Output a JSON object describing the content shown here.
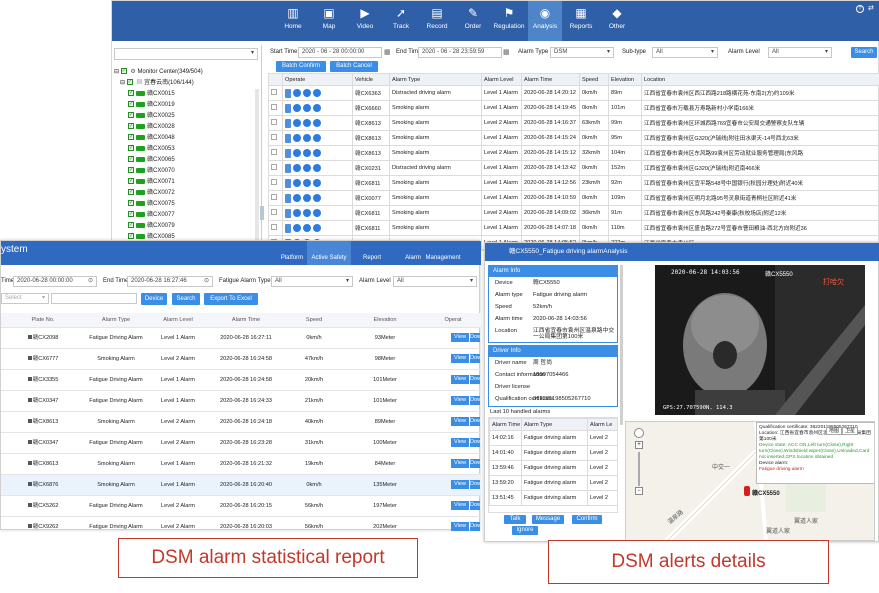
{
  "main": {
    "nav": [
      {
        "label": "Home",
        "icon": "bar-chart-icon"
      },
      {
        "label": "Map",
        "icon": "map-icon"
      },
      {
        "label": "Video",
        "icon": "video-icon"
      },
      {
        "label": "Track",
        "icon": "track-icon"
      },
      {
        "label": "Record",
        "icon": "record-icon"
      },
      {
        "label": "Order",
        "icon": "order-icon"
      },
      {
        "label": "Regulation",
        "icon": "regulation-icon"
      },
      {
        "label": "Analysis",
        "icon": "analysis-icon",
        "active": true
      },
      {
        "label": "Reports",
        "icon": "reports-icon"
      },
      {
        "label": "Other",
        "icon": "cube-icon"
      }
    ],
    "filters": {
      "start_label": "Start Time",
      "start_value": "2020 - 06 - 28 00:00:00",
      "end_label": "End Time",
      "end_value": "2020 - 06 - 28 23:59:59",
      "alarm_type_label": "Alarm Type",
      "alarm_type_value": "DSM",
      "subtype_label": "Sub-type",
      "subtype_value": "All",
      "alarm_level_label": "Alarm Level",
      "alarm_level_value": "All",
      "search": "Search",
      "batch_confirm": "Batch Confirm",
      "batch_cancel": "Batch Cancel"
    },
    "tree": {
      "root": "Monitor Center(349/504)",
      "group": "宜春云南(106/144)",
      "vehicles": [
        "赣CX0015",
        "赣CX0019",
        "赣CX0025",
        "赣CX0028",
        "赣CX0048",
        "赣CX0053",
        "赣CX0065",
        "赣CX0070",
        "赣CX0071",
        "赣CX0072",
        "赣CX0075",
        "赣CX0077",
        "赣CX0079",
        "赣CX0085"
      ]
    },
    "columns": [
      "Operate",
      "Vehicle",
      "Alarm Type",
      "Alarm Level",
      "Alarm Time",
      "Speed",
      "Elevation",
      "Location"
    ],
    "rows": [
      [
        "赣CX6363",
        "Distracted driving alarm",
        "Level 1 Alarm",
        "2020-06-28 14:20:12",
        "0km/h",
        "89m",
        "江西省宜春市袁州区西江西路218路横花苑-东南2(方)约109米"
      ],
      [
        "赣CX6660",
        "Smoking alarm",
        "Level 1 Alarm",
        "2020-06-28 14:19:45",
        "0km/h",
        "101m",
        "江西省宜春市万载县万寿路新村小学南166米"
      ],
      [
        "赣CX8613",
        "Smoking alarm",
        "Level 2 Alarm",
        "2020-06-28 14:16:37",
        "63km/h",
        "99m",
        "江西省宜春市袁州区环城西路769宜春市公安局交通警察支队车辆"
      ],
      [
        "赣CX8613",
        "Smoking alarm",
        "Level 1 Alarm",
        "2020-06-28 14:15:24",
        "0km/h",
        "95m",
        "江西省宜春市袁州区G320(沪瑞线)附往田水渠天-14号西北63米"
      ],
      [
        "赣CX8613",
        "Smoking alarm",
        "Level 2 Alarm",
        "2020-06-28 14:15:12",
        "32km/h",
        "104m",
        "江西省宜春市袁州区东风路99袁州区劳动就业服务管理局(东风路"
      ],
      [
        "赣CX0231",
        "Distracted driving alarm",
        "Level 1 Alarm",
        "2020-06-28 14:13:42",
        "0km/h",
        "152m",
        "江西省宜春市袁州区G320(沪瑞线)附近南466米"
      ],
      [
        "赣CX6811",
        "Smoking alarm",
        "Level 1 Alarm",
        "2020-06-28 14:12:56",
        "23km/h",
        "92m",
        "江西省宜春市袁州区宜平路548号中国银行(秋园分理处)附近40米"
      ],
      [
        "赣CX0077",
        "Smoking alarm",
        "Level 1 Alarm",
        "2020-06-28 14:10:59",
        "0km/h",
        "109m",
        "江西省宜春市袁州区明月北路95号灵泉街道青桐社区附近41米"
      ],
      [
        "赣CX6811",
        "Smoking alarm",
        "Level 2 Alarm",
        "2020-06-28 14:09:02",
        "36km/h",
        "91m",
        "江西省宜春市袁州区东风路242号秦康(秋校场店)附近12米"
      ],
      [
        "赣CX6811",
        "Smoking alarm",
        "Level 1 Alarm",
        "2020-06-28 14:07:18",
        "0km/h",
        "110m",
        "江西省宜春市袁州区盛吉路272号宜春市曹田粮油-西北方向附近36"
      ],
      [
        "赣CX5550",
        "Fatigue driving alarm",
        "Level 1 Alarm",
        "2020-06-28 14:05:52",
        "0km/h",
        "222m",
        "江西省宜春市袁州区"
      ]
    ]
  },
  "report": {
    "title": "ystem",
    "tabs": [
      "Platform",
      "Active Safety",
      "Report",
      "Alarm",
      "Management"
    ],
    "start_label": "Time",
    "start_value": "2020-06-28 00:00:00",
    "end_label": "End Time",
    "end_value": "2020-06-28 16:27:46",
    "fat_label": "Fatigue Alarm Type",
    "fat_value": "All",
    "alarm_level_label": "Alarm Level",
    "alarm_level_value": "All",
    "select_ph": "Select",
    "device": "Device",
    "search": "Search",
    "export": "Export To Excel",
    "columns": [
      "Plate No.",
      "Alarm Type",
      "Alarm Level",
      "Alarm Time",
      "Speed",
      "Elevation",
      "Operat"
    ],
    "view": "View",
    "down": "Dow",
    "rows": [
      [
        "赣CX2098",
        "Fatigue Driving Alarm",
        "Level 1 Alarm",
        "2020-06-28 16:27:11",
        "0km/h",
        "93Meter"
      ],
      [
        "赣CX6777",
        "Smoking Alarm",
        "Level 2 Alarm",
        "2020-06-28 16:24:58",
        "47km/h",
        "98Meter"
      ],
      [
        "赣CX3355",
        "Fatigue Driving Alarm",
        "Level 1 Alarm",
        "2020-06-28 16:24:58",
        "20km/h",
        "101Meter"
      ],
      [
        "赣CX0347",
        "Fatigue Driving Alarm",
        "Level 1 Alarm",
        "2020-06-28 16:24:33",
        "21km/h",
        "101Meter"
      ],
      [
        "赣CX8613",
        "Smoking Alarm",
        "Level 2 Alarm",
        "2020-06-28 16:24:18",
        "40km/h",
        "89Meter"
      ],
      [
        "赣CX0347",
        "Fatigue Driving Alarm",
        "Level 2 Alarm",
        "2020-06-28 16:23:28",
        "31km/h",
        "100Meter"
      ],
      [
        "赣CX8613",
        "Smoking Alarm",
        "Level 1 Alarm",
        "2020-06-28 16:21:32",
        "19km/h",
        "84Meter"
      ],
      [
        "赣CX6876",
        "Smoking Alarm",
        "Level 1 Alarm",
        "2020-06-28 16:20:40",
        "0km/h",
        "135Meter"
      ],
      [
        "赣CX5262",
        "Fatigue Driving Alarm",
        "Level 2 Alarm",
        "2020-06-28 16:20:15",
        "56km/h",
        "197Meter"
      ],
      [
        "赣CX9262",
        "Fatigue Driving Alarm",
        "Level 2 Alarm",
        "2020-06-28 16:20:03",
        "56km/h",
        "202Meter"
      ]
    ]
  },
  "details": {
    "title": "赣CX5550_Fatigue driving alarmAnalysis",
    "alarm_info": "Alarm Info",
    "alarm": [
      {
        "k": "Device",
        "v": "赣CX5550"
      },
      {
        "k": "Alarm type",
        "v": "Fatigue driving alarm"
      },
      {
        "k": "Speed",
        "v": "52km/h"
      },
      {
        "k": "Alarm time",
        "v": "2020-06-28 14:03:56"
      },
      {
        "k": "Location",
        "v": "江西省宜春市袁州区温泉路中交一公局集团第100米"
      }
    ],
    "driver_info": "Driver Info",
    "driver": [
      {
        "k": "Driver name",
        "v": "周 哲尚"
      },
      {
        "k": "Contact information",
        "v": "18907054466"
      },
      {
        "k": "Driver license",
        "v": ""
      },
      {
        "k": "Qualification certificate",
        "v": "362201198505267710"
      }
    ],
    "handled_label": "Last 10 handled alarms",
    "handled_cols": [
      "Alarm Time",
      "Alarm Type",
      "Alarm Le"
    ],
    "handled": [
      [
        "14:02:16",
        "Fatigue driving alarm",
        "Level 2"
      ],
      [
        "14:01:40",
        "Fatigue driving alarm",
        "Level 2"
      ],
      [
        "13:59:46",
        "Fatigue driving alarm",
        "Level 2"
      ],
      [
        "13:59:20",
        "Fatigue driving alarm",
        "Level 2"
      ],
      [
        "13:51:45",
        "Fatigue driving alarm",
        "Level 2"
      ]
    ],
    "buttons": [
      "Talk",
      "Message",
      "Confirm",
      "Ignore"
    ],
    "cam_time": "2020-06-28 14:03:56",
    "cam_plate": "赣CX5550",
    "cam_tag": "打哈欠",
    "cam_gps": "GPS:27.707590N, 114.3",
    "popup": {
      "qual": "Qualification certificate: 362201198505267710",
      "loc": "Location: 江西省宜春市袁州区温泉路中交一公局集团第100米",
      "state": "Device state: ACC ON,Left turn(Close),Right turn(Close),Windshield wiper(Close),Unloaded,Card not inserted,GPS location obtained",
      "alarm_label": "Device alarm:",
      "alarm_val": "Fatigue driving alarm"
    },
    "map_plate": "赣CX5550",
    "map_labels": [
      "温泉路",
      "中交一",
      "翼道人家",
      "翼道人家"
    ],
    "map_btns": [
      "地图",
      "卫星"
    ]
  },
  "captions": {
    "left": "DSM alarm statistical report",
    "right": "DSM alerts details"
  }
}
